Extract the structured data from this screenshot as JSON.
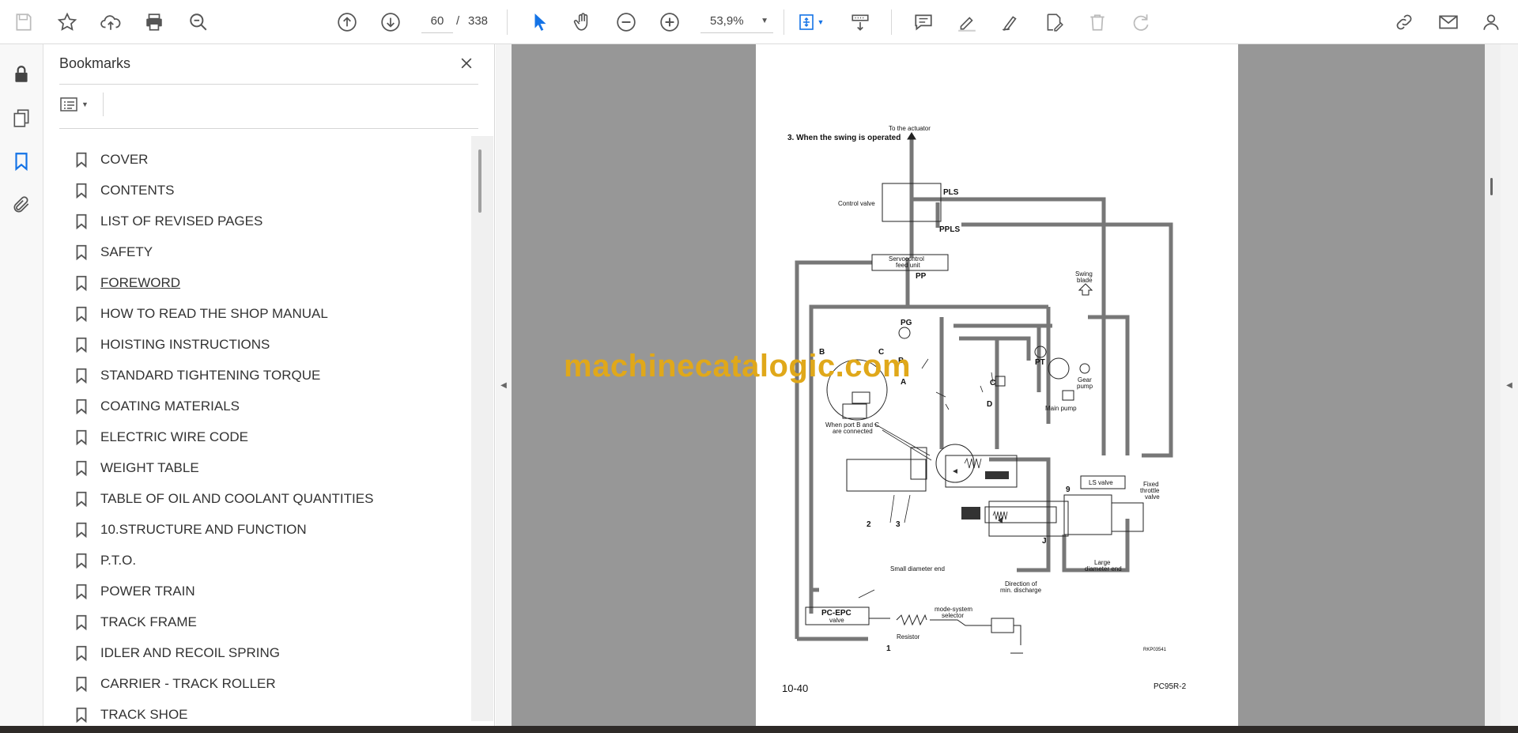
{
  "toolbar": {
    "page_current": "60",
    "page_separator": "/",
    "page_total": "338",
    "zoom": "53,9%"
  },
  "bookmarks": {
    "title": "Bookmarks",
    "items": [
      {
        "label": "COVER"
      },
      {
        "label": "CONTENTS"
      },
      {
        "label": "LIST OF REVISED PAGES"
      },
      {
        "label": "SAFETY"
      },
      {
        "label": "FOREWORD"
      },
      {
        "label": "HOW TO READ THE SHOP MANUAL"
      },
      {
        "label": "HOISTING INSTRUCTIONS"
      },
      {
        "label": "STANDARD TIGHTENING TORQUE"
      },
      {
        "label": "COATING MATERIALS"
      },
      {
        "label": "ELECTRIC WIRE CODE"
      },
      {
        "label": "WEIGHT TABLE"
      },
      {
        "label": "TABLE OF OIL AND COOLANT QUANTITIES"
      },
      {
        "label": "10.STRUCTURE AND FUNCTION"
      },
      {
        "label": "P.T.O."
      },
      {
        "label": "POWER TRAIN"
      },
      {
        "label": "TRACK FRAME"
      },
      {
        "label": "IDLER AND RECOIL SPRING"
      },
      {
        "label": "CARRIER - TRACK ROLLER"
      },
      {
        "label": "TRACK SHOE"
      }
    ]
  },
  "document": {
    "heading": "3.  When the swing is operated",
    "page_number": "10-40",
    "model": "PC95R-2",
    "watermark": "machinecatalogic.com",
    "diagram_labels": {
      "to_actuator": "To the actuator",
      "control_valve": "Control valve",
      "pls": "PLS",
      "ppls": "PPLS",
      "servocontrol": "Servocontrol",
      "feed_unit": "feed unit",
      "pp": "PP",
      "swing": "Swing",
      "blade": "blade",
      "pg": "PG",
      "pt": "PT",
      "gear": "Gear",
      "pump": "pump",
      "main_pump": "Main pump",
      "b": "B",
      "c": "C",
      "a": "A",
      "d": "D",
      "when_port": "When port B and C",
      "are_connected": "are connected",
      "ls_valve": "LS valve",
      "fixed": "Fixed",
      "throttle": "throttle",
      "valve": "valve",
      "n9": "9",
      "n2": "2",
      "n3": "3",
      "j": "J",
      "small_end": "Small diameter end",
      "large": "Large",
      "diameter_end": "diameter end",
      "direction_of": "Direction of",
      "min_discharge": "min. discharge",
      "pc_epc": "PC-EPC",
      "pc_epc_valve": "valve",
      "mode_system": "mode-system",
      "selector": "selector",
      "resistor": "Resistor",
      "n1": "1",
      "ref_code": "RKP03541"
    }
  }
}
